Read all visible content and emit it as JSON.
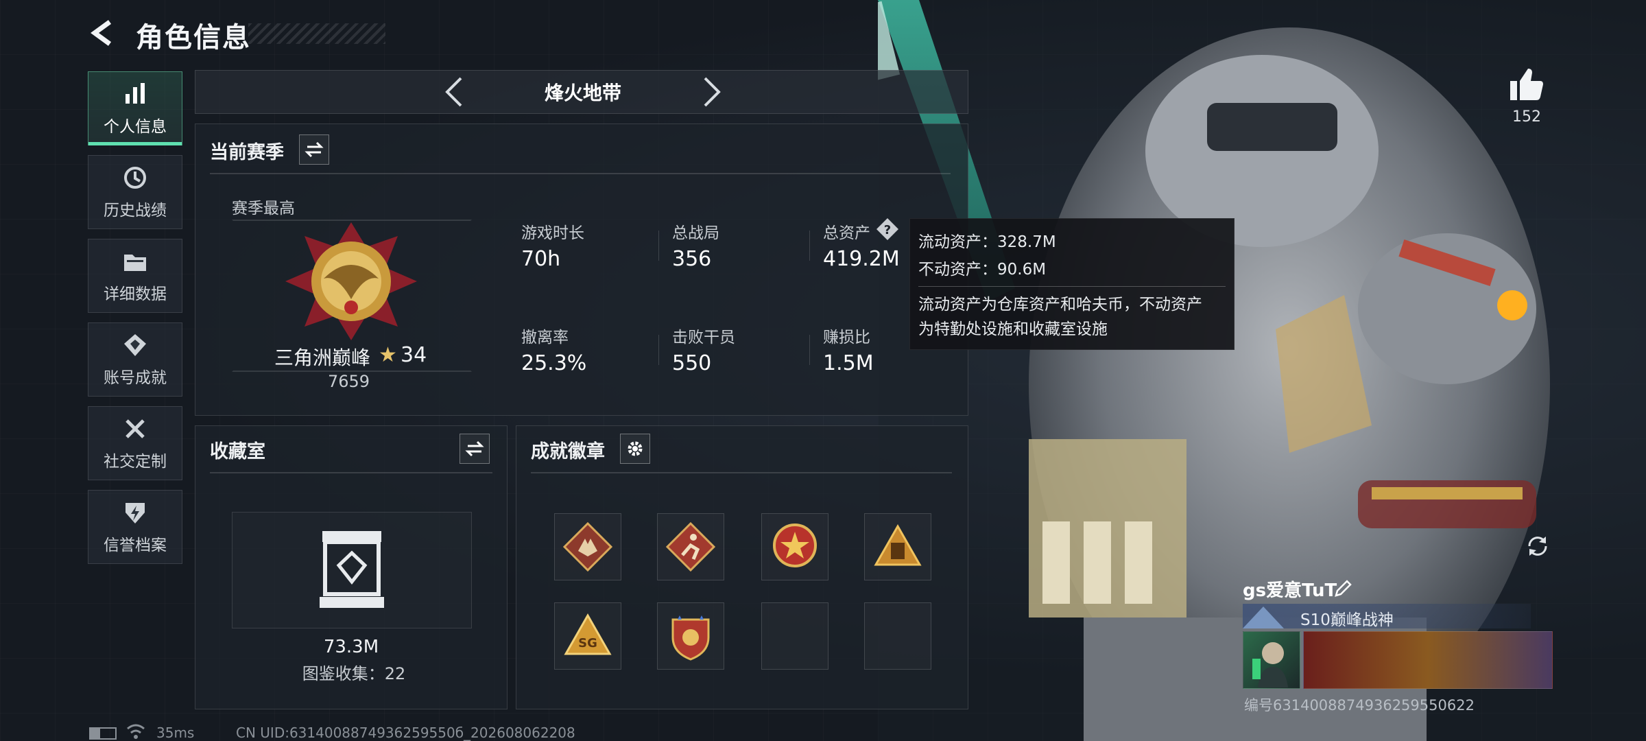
{
  "header": {
    "title": "角色信息"
  },
  "sidebar": {
    "items": [
      {
        "label": "个人信息",
        "icon": "bar-chart-icon",
        "active": true
      },
      {
        "label": "历史战绩",
        "icon": "history-clock-icon",
        "active": false
      },
      {
        "label": "详细数据",
        "icon": "folder-icon",
        "active": false
      },
      {
        "label": "账号成就",
        "icon": "achievement-badge-icon",
        "active": false
      },
      {
        "label": "社交定制",
        "icon": "tools-icon",
        "active": false
      },
      {
        "label": "信誉档案",
        "icon": "shield-bolt-icon",
        "active": false
      }
    ]
  },
  "mode_selector": {
    "label": "烽火地带"
  },
  "season": {
    "title": "当前赛季",
    "best_label": "赛季最高",
    "rank_name": "三角洲巅峰",
    "rank_stars": "34",
    "rank_score": "7659",
    "stats": [
      {
        "key": "游戏时长",
        "value": "70h"
      },
      {
        "key": "总战局",
        "value": "356"
      },
      {
        "key": "总资产",
        "value": "419.2M"
      },
      {
        "key": "撤离率",
        "value": "25.3%"
      },
      {
        "key": "击败干员",
        "value": "550"
      },
      {
        "key": "赚损比",
        "value": "1.5M"
      }
    ]
  },
  "tooltip": {
    "liquid": "流动资产：328.7M",
    "fixed": "不动资产：90.6M",
    "desc_line1": "流动资产为仓库资产和哈夫币，不动资产",
    "desc_line2": "为特勤处设施和收藏室设施"
  },
  "collection": {
    "title": "收藏室",
    "value": "73.3M",
    "count_label": "图鉴收集：22"
  },
  "badges": {
    "title": "成就徽章",
    "items": [
      "wolf-badge-icon",
      "runner-badge-icon",
      "star-medal-icon",
      "pyramid-badge-icon",
      "sg-triangle-badge-icon",
      "shield-star-badge-icon",
      "",
      ""
    ]
  },
  "likes": {
    "count": "152"
  },
  "player": {
    "name": "gs爱意TuT",
    "title": "S10巅峰战神",
    "id_line": "编号6314008874936259550622"
  },
  "footer": {
    "ping": "35ms",
    "uid": "CN UID:6314008874936259550б_202608062208"
  },
  "colors": {
    "accent": "#5fe0b0",
    "panel_bg": "#1c222a",
    "background": "#151a21"
  }
}
